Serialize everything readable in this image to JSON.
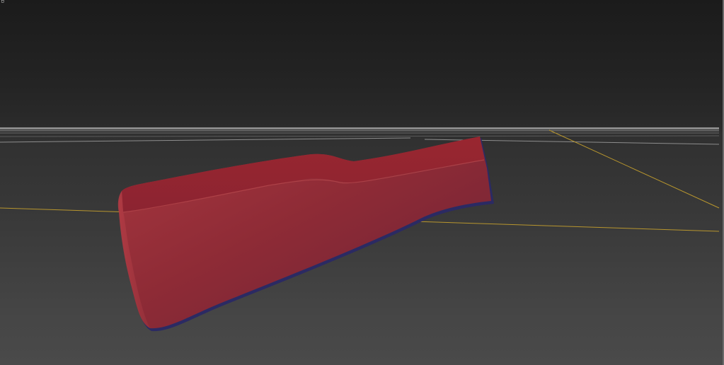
{
  "viewport": {
    "corner_label": "▫",
    "background_top": "#1b1b1b",
    "background_bottom": "#4a4a4a",
    "axis_color": "#b8962e",
    "grid_line_color": "#9a9a9a",
    "object_color": "#9b2a36",
    "object_edge_color": "#2a2a6a"
  }
}
